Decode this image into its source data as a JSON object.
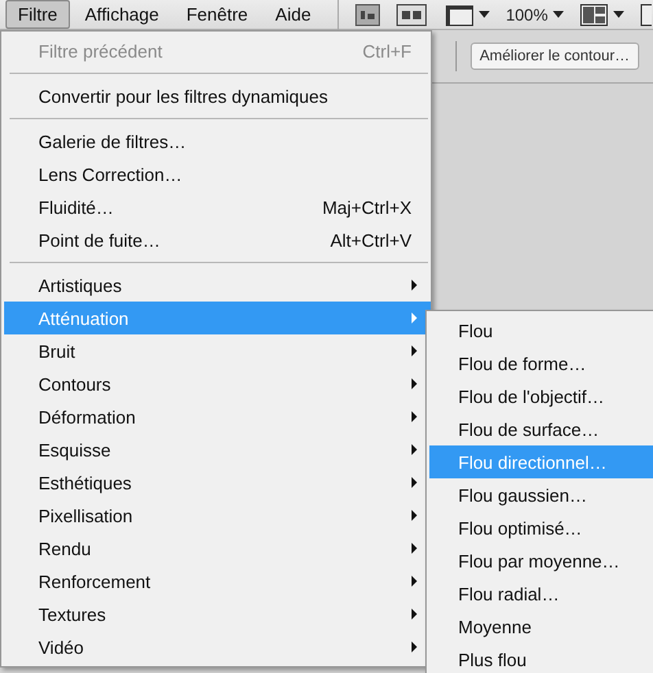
{
  "menubar": {
    "items": [
      {
        "label": "Filtre",
        "selected": true
      },
      {
        "label": "Affichage",
        "selected": false
      },
      {
        "label": "Fenêtre",
        "selected": false
      },
      {
        "label": "Aide",
        "selected": false
      }
    ]
  },
  "toolbar": {
    "zoom": "100%"
  },
  "options_bar": {
    "button": "Améliorer le contour…"
  },
  "menu": {
    "items": [
      {
        "kind": "item",
        "label": "Filtre précédent",
        "shortcut": "Ctrl+F",
        "disabled": true,
        "selected": false
      },
      {
        "kind": "separator"
      },
      {
        "kind": "item",
        "label": "Convertir pour les filtres dynamiques",
        "disabled": false,
        "selected": false
      },
      {
        "kind": "separator"
      },
      {
        "kind": "item",
        "label": "Galerie de filtres…",
        "disabled": false,
        "selected": false
      },
      {
        "kind": "item",
        "label": "Lens Correction…",
        "disabled": false,
        "selected": false
      },
      {
        "kind": "item",
        "label": "Fluidité…",
        "shortcut": "Maj+Ctrl+X",
        "disabled": false,
        "selected": false
      },
      {
        "kind": "item",
        "label": "Point de fuite…",
        "shortcut": "Alt+Ctrl+V",
        "disabled": false,
        "selected": false
      },
      {
        "kind": "separator"
      },
      {
        "kind": "submenu",
        "label": "Artistiques",
        "disabled": false,
        "selected": false
      },
      {
        "kind": "submenu",
        "label": "Atténuation",
        "disabled": false,
        "selected": true
      },
      {
        "kind": "submenu",
        "label": "Bruit",
        "disabled": false,
        "selected": false
      },
      {
        "kind": "submenu",
        "label": "Contours",
        "disabled": false,
        "selected": false
      },
      {
        "kind": "submenu",
        "label": "Déformation",
        "disabled": false,
        "selected": false
      },
      {
        "kind": "submenu",
        "label": "Esquisse",
        "disabled": false,
        "selected": false
      },
      {
        "kind": "submenu",
        "label": "Esthétiques",
        "disabled": false,
        "selected": false
      },
      {
        "kind": "submenu",
        "label": "Pixellisation",
        "disabled": false,
        "selected": false
      },
      {
        "kind": "submenu",
        "label": "Rendu",
        "disabled": false,
        "selected": false
      },
      {
        "kind": "submenu",
        "label": "Renforcement",
        "disabled": false,
        "selected": false
      },
      {
        "kind": "submenu",
        "label": "Textures",
        "disabled": false,
        "selected": false
      },
      {
        "kind": "submenu",
        "label": "Vidéo",
        "disabled": false,
        "selected": false
      }
    ]
  },
  "submenu": {
    "items": [
      {
        "kind": "item",
        "label": "Flou",
        "disabled": false,
        "selected": false
      },
      {
        "kind": "item",
        "label": "Flou de forme…",
        "disabled": false,
        "selected": false
      },
      {
        "kind": "item",
        "label": "Flou de l'objectif…",
        "disabled": false,
        "selected": false
      },
      {
        "kind": "item",
        "label": "Flou de surface…",
        "disabled": false,
        "selected": false
      },
      {
        "kind": "item",
        "label": "Flou directionnel…",
        "disabled": false,
        "selected": true
      },
      {
        "kind": "item",
        "label": "Flou gaussien…",
        "disabled": false,
        "selected": false
      },
      {
        "kind": "item",
        "label": "Flou optimisé…",
        "disabled": false,
        "selected": false
      },
      {
        "kind": "item",
        "label": "Flou par moyenne…",
        "disabled": false,
        "selected": false
      },
      {
        "kind": "item",
        "label": "Flou radial…",
        "disabled": false,
        "selected": false
      },
      {
        "kind": "item",
        "label": "Moyenne",
        "disabled": false,
        "selected": false
      },
      {
        "kind": "item",
        "label": "Plus flou",
        "disabled": false,
        "selected": false
      }
    ]
  }
}
